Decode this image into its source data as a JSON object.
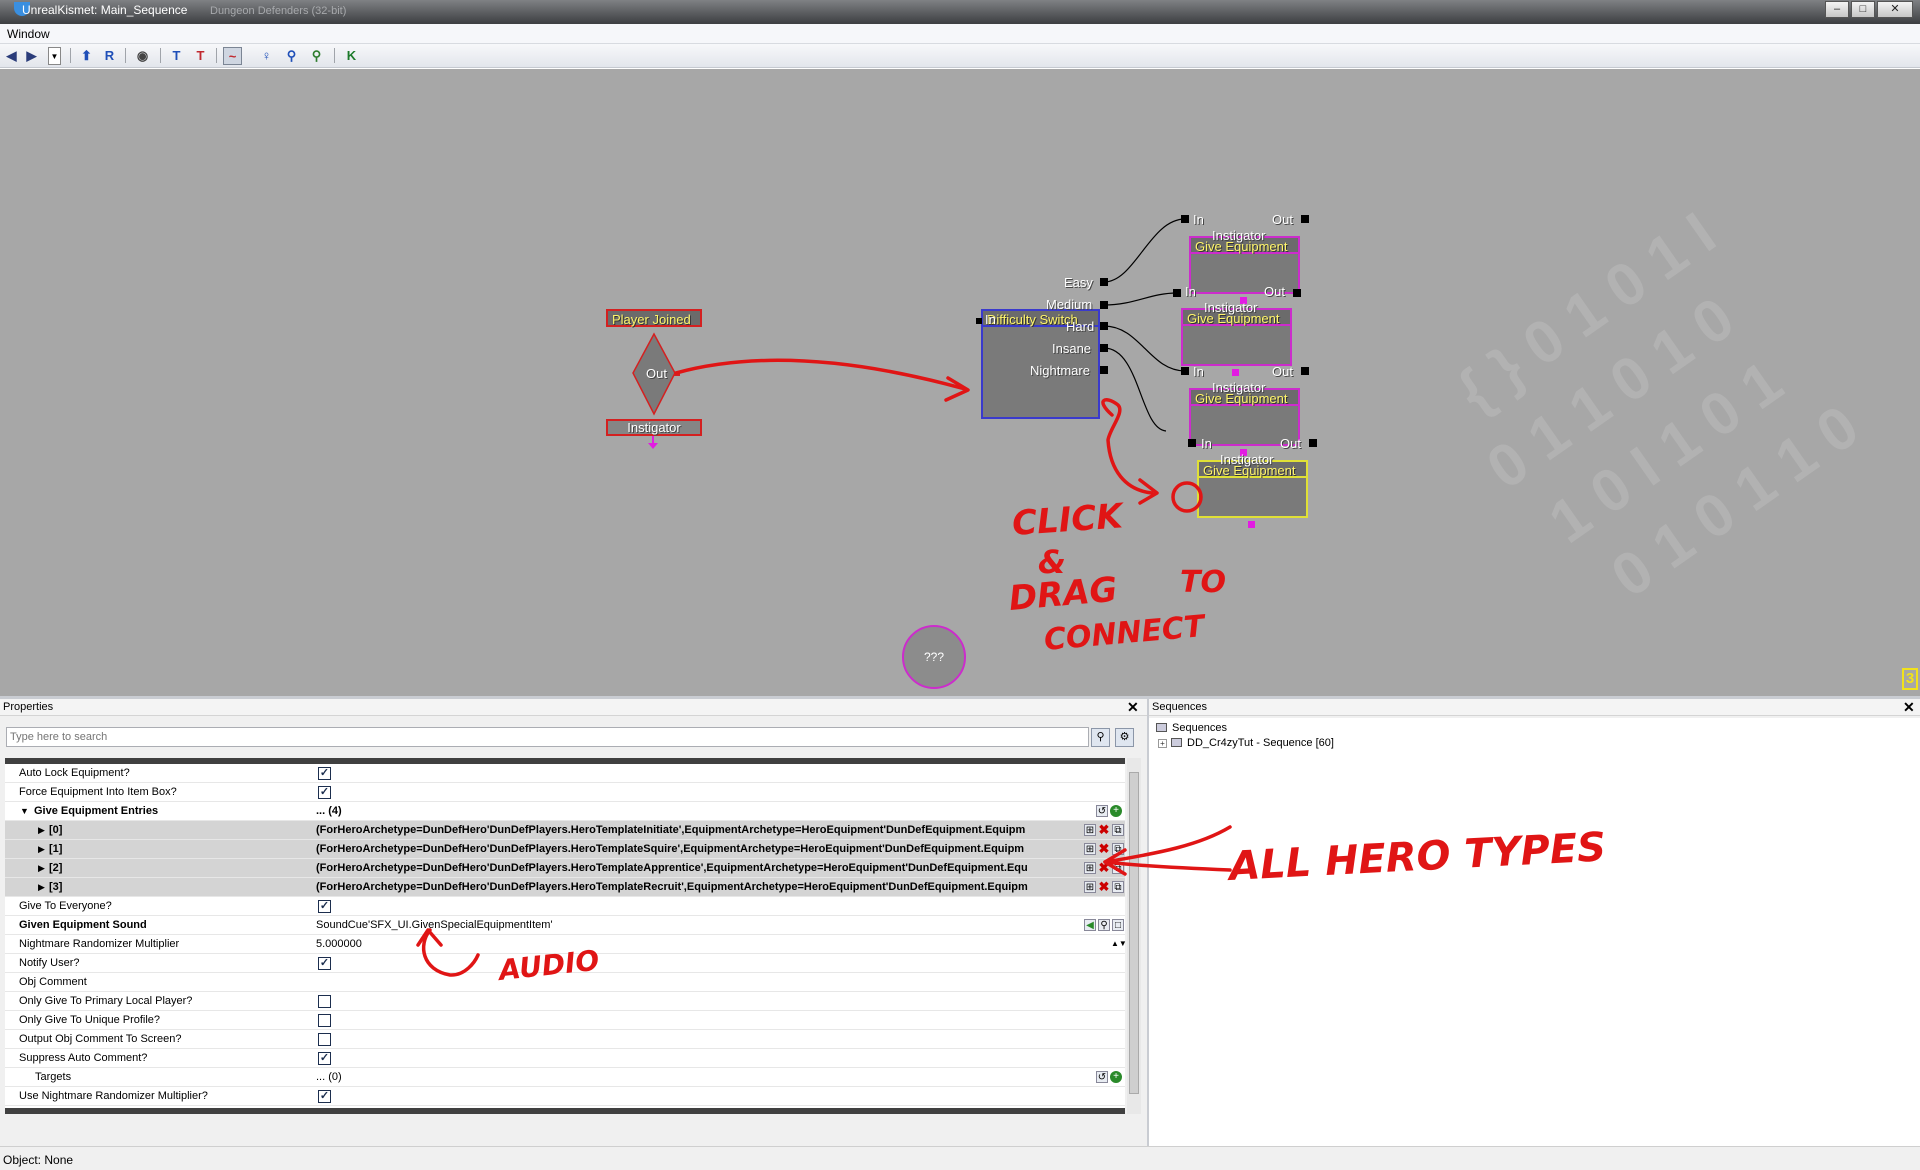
{
  "window": {
    "title": "UnrealKismet: Main_Sequence",
    "ghost_tab": "Dungeon Defenders (32-bit)"
  },
  "menu": {
    "window": "Window"
  },
  "toolbar_icons": [
    "back-arrow-icon",
    "forward-arrow-icon",
    "dropdown-icon",
    "parent-sequence-icon",
    "rename-icon",
    "eye-icon",
    "hide-connectors-icon",
    "show-connectors-icon",
    "curve-icon",
    "bulb-icon",
    "search-icon",
    "zoom-icon",
    "kismet-k-icon"
  ],
  "graph": {
    "event": {
      "title": "Player Joined",
      "out": "Out",
      "instigator": "Instigator"
    },
    "switch": {
      "title": "Difficulty Switch",
      "in": "In",
      "outputs": [
        "Easy",
        "Medium",
        "Hard",
        "Insane",
        "Nightmare"
      ]
    },
    "give_nodes": [
      {
        "title": "Give Equipment",
        "in": "In",
        "out": "Out",
        "instigator": "Instigator"
      },
      {
        "title": "Give Equipment",
        "in": "In",
        "out": "Out",
        "instigator": "Instigator"
      },
      {
        "title": "Give Equipment",
        "in": "In",
        "out": "Out",
        "instigator": "Instigator"
      },
      {
        "title": "Give Equipment",
        "in": "In",
        "out": "Out",
        "instigator": "Instigator"
      }
    ],
    "unknown_var": "???",
    "logo": "3"
  },
  "annotations": {
    "click_drag": "CLICK & DRAG TO CONNECT",
    "hero_types": "ALL HERO TYPES",
    "audio": "AUDIO"
  },
  "properties": {
    "header": "Properties",
    "search_placeholder": "Type here to search",
    "rows": [
      {
        "name": "Auto Lock Equipment?",
        "checked": true
      },
      {
        "name": "Force Equipment Into Item Box?",
        "checked": true
      },
      {
        "name": "Give Equipment Entries",
        "value": "... (4)"
      },
      {
        "name": "[0]",
        "value": "(ForHeroArchetype=DunDefHero'DunDefPlayers.HeroTemplateInitiate',EquipmentArchetype=HeroEquipment'DunDefEquipment.Equipm"
      },
      {
        "name": "[1]",
        "value": "(ForHeroArchetype=DunDefHero'DunDefPlayers.HeroTemplateSquire',EquipmentArchetype=HeroEquipment'DunDefEquipment.Equipm"
      },
      {
        "name": "[2]",
        "value": "(ForHeroArchetype=DunDefHero'DunDefPlayers.HeroTemplateApprentice',EquipmentArchetype=HeroEquipment'DunDefEquipment.Equ"
      },
      {
        "name": "[3]",
        "value": "(ForHeroArchetype=DunDefHero'DunDefPlayers.HeroTemplateRecruit',EquipmentArchetype=HeroEquipment'DunDefEquipment.Equipm"
      },
      {
        "name": "Give To Everyone?",
        "checked": true
      },
      {
        "name": "Given Equipment Sound",
        "value": "SoundCue'SFX_UI.GivenSpecialEquipmentItem'"
      },
      {
        "name": "Nightmare Randomizer Multiplier",
        "value": "5.000000"
      },
      {
        "name": "Notify User?",
        "checked": true
      },
      {
        "name": "Obj Comment",
        "value": ""
      },
      {
        "name": "Only Give To Primary Local Player?",
        "checked": false
      },
      {
        "name": "Only Give To Unique Profile?",
        "checked": false
      },
      {
        "name": "Output Obj Comment To Screen?",
        "checked": false
      },
      {
        "name": "Suppress Auto Comment?",
        "checked": true
      },
      {
        "name": "Targets",
        "value": "... (0)"
      },
      {
        "name": "Use Nightmare Randomizer Multiplier?",
        "checked": true
      }
    ]
  },
  "sequences": {
    "header": "Sequences",
    "root": "Sequences",
    "child": "DD_Cr4zyTut - Sequence [60]"
  },
  "status": {
    "text": "Object: None"
  },
  "colors": {
    "canvas": "#a7a7a7",
    "event_border": "#d42020",
    "switch_border": "#3a3acc",
    "action_border": "#cc2ccc",
    "selected_border": "#e0e036",
    "annotation": "#e01515",
    "title_text": "#fff56a"
  }
}
